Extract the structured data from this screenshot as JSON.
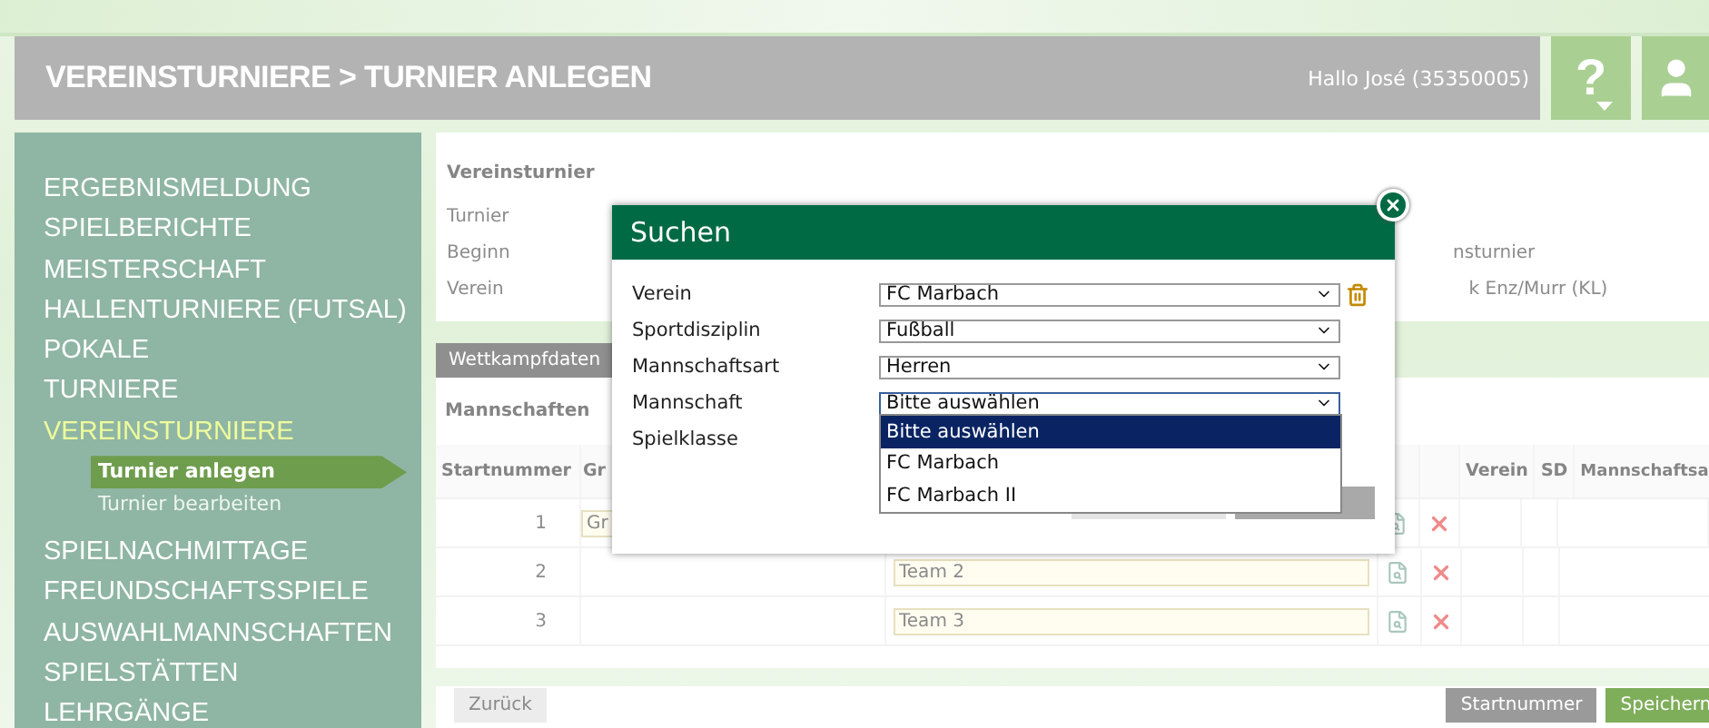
{
  "header": {
    "title": "VEREINSTURNIERE > TURNIER ANLEGEN",
    "greeting": "Hallo José (35350005)",
    "help_label": "?"
  },
  "sidebar": {
    "items": [
      {
        "label": "ERGEBNISMELDUNG",
        "selected": false
      },
      {
        "label": "SPIELBERICHTE",
        "selected": false
      },
      {
        "label": "MEISTERSCHAFT",
        "selected": false
      },
      {
        "label": "HALLENTURNIERE (FUTSAL)",
        "selected": false
      },
      {
        "label": "POKALE",
        "selected": false
      },
      {
        "label": "TURNIERE",
        "selected": false
      },
      {
        "label": "VEREINSTURNIERE",
        "selected": true,
        "children": [
          {
            "label": "Turnier anlegen",
            "selected": true
          },
          {
            "label": "Turnier bearbeiten",
            "selected": false
          }
        ]
      },
      {
        "label": "SPIELNACHMITTAGE",
        "selected": false
      },
      {
        "label": "FREUNDSCHAFTSSPIELE",
        "selected": false
      },
      {
        "label": "AUSWAHLMANNSCHAFTEN",
        "selected": false
      },
      {
        "label": "SPIELSTÄTTEN",
        "selected": false
      },
      {
        "label": "LEHRGÄNGE",
        "selected": false
      }
    ]
  },
  "tournament_panel": {
    "title": "Vereinsturnier",
    "rows": [
      {
        "label": "Turnier"
      },
      {
        "label": "Beginn",
        "value": "nsturnier"
      },
      {
        "label": "Verein",
        "value": "k Enz/Murr (KL)"
      }
    ]
  },
  "tabs": [
    {
      "label": "Wettkampfdaten",
      "selected": true
    }
  ],
  "teams": {
    "title": "Mannschaften",
    "columns": [
      {
        "label": "Startnummer"
      },
      {
        "label": "Gr"
      },
      {},
      {},
      {},
      {
        "label": "Verein"
      },
      {
        "label": "SD"
      },
      {
        "label": "Mannschaftsa"
      }
    ],
    "rows": [
      {
        "number": "1",
        "group": "Gr"
      },
      {
        "number": "2",
        "team": "Team 2"
      },
      {
        "number": "3",
        "team": "Team 3"
      }
    ]
  },
  "footer_buttons": [
    {
      "label": "Zurück",
      "kind": "plain"
    },
    {
      "label": "Startnummer",
      "kind": "secondary"
    },
    {
      "label": "Speichern",
      "kind": "primary"
    }
  ],
  "dialog": {
    "title": "Suchen",
    "fields": [
      {
        "label": "Verein",
        "kind": "select",
        "value": "FC Marbach",
        "clearable": true,
        "expanded": false
      },
      {
        "label": "Sportdisziplin",
        "kind": "select",
        "value": "Fußball",
        "clearable": false,
        "expanded": false
      },
      {
        "label": "Mannschaftsart",
        "kind": "select",
        "value": "Herren",
        "clearable": false,
        "expanded": false
      },
      {
        "label": "Mannschaft",
        "kind": "select",
        "value": "Bitte auswählen",
        "clearable": false,
        "expanded": true,
        "options": [
          {
            "label": "Bitte auswählen",
            "selected": true
          },
          {
            "label": "FC Marbach",
            "selected": false
          },
          {
            "label": "FC Marbach II",
            "selected": false
          }
        ]
      },
      {
        "label": "Spielklasse",
        "kind": "covered"
      }
    ],
    "buttons": [
      {
        "kind": "primary"
      },
      {
        "kind": "secondary"
      }
    ]
  }
}
